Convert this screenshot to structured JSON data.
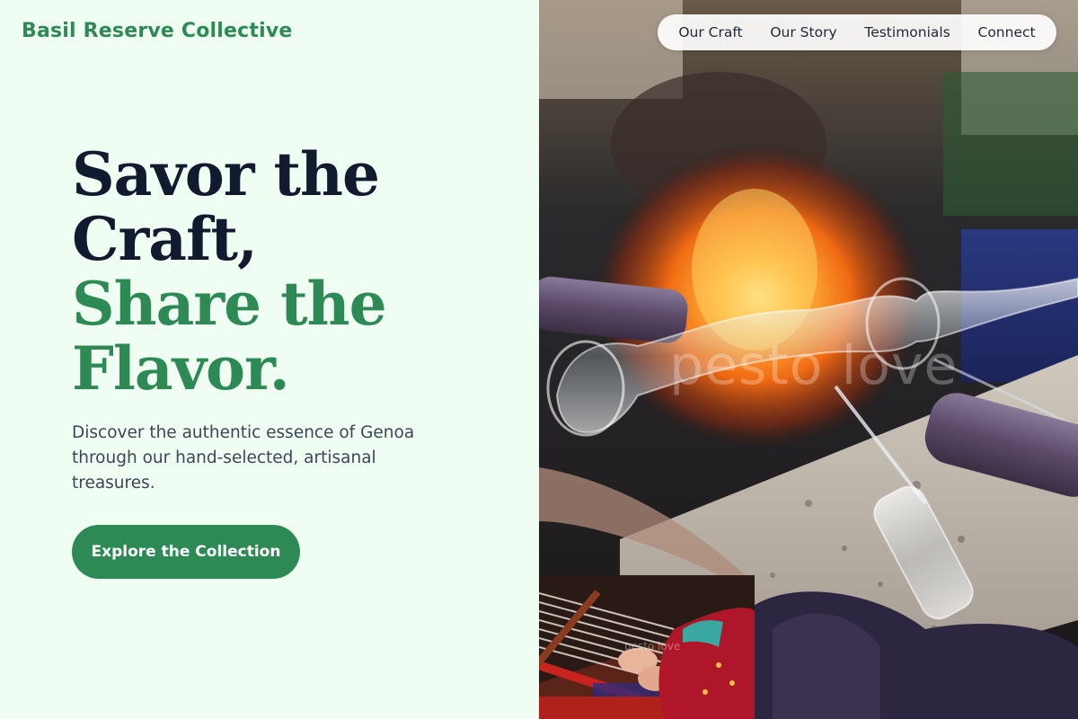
{
  "brand": {
    "name": "Basil Reserve Collective"
  },
  "nav": {
    "items": [
      {
        "label": "Our Craft"
      },
      {
        "label": "Our Story"
      },
      {
        "label": "Testimonials"
      },
      {
        "label": "Connect"
      }
    ]
  },
  "hero": {
    "headline_dark": [
      "Savor the",
      "Craft,"
    ],
    "headline_green": [
      "Share the",
      "Flavor."
    ],
    "lede": "Discover the authentic essence of Genoa through our hand-selected, artisanal treasures.",
    "cta_label": "Explore the Collection"
  },
  "media": {
    "main_photo_watermark": "pesto love",
    "inset_photo_watermark": "pesto love"
  },
  "colors": {
    "background": "#f0fdf2",
    "accent_green": "#2e8a55",
    "heading_dark": "#111a2e",
    "body_text": "#3c4656"
  }
}
